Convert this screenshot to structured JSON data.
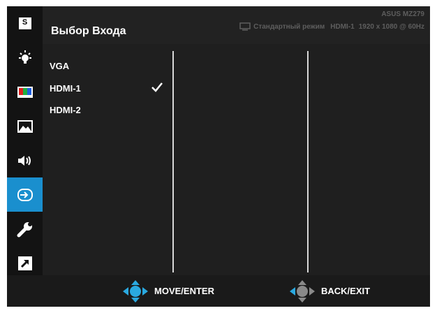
{
  "header": {
    "title": "Выбор Входа",
    "model": "ASUS MZ279",
    "mode": "Стандартный режим",
    "input": "HDMI-1",
    "resolution": "1920 x 1080 @ 60Hz"
  },
  "sidebar": {
    "items": [
      {
        "name": "splendid",
        "icon": "s-icon"
      },
      {
        "name": "blue-light-filter",
        "icon": "bulb-icon"
      },
      {
        "name": "color",
        "icon": "color-bars-icon"
      },
      {
        "name": "image",
        "icon": "image-icon"
      },
      {
        "name": "sound",
        "icon": "speaker-icon"
      },
      {
        "name": "input-select",
        "icon": "input-icon",
        "active": true
      },
      {
        "name": "system-setup",
        "icon": "wrench-icon"
      },
      {
        "name": "shortcut",
        "icon": "shortcut-icon"
      }
    ],
    "s_label": "S"
  },
  "options": [
    {
      "label": "VGA",
      "selected": false
    },
    {
      "label": "HDMI-1",
      "selected": true
    },
    {
      "label": "HDMI-2",
      "selected": false
    }
  ],
  "footer": {
    "move_label": "MOVE/ENTER",
    "back_label": "BACK/EXIT"
  },
  "colors": {
    "accent": "#1a8fce",
    "background": "#1d1d1d",
    "text": "#ffffff",
    "muted": "#5e5e5e"
  }
}
